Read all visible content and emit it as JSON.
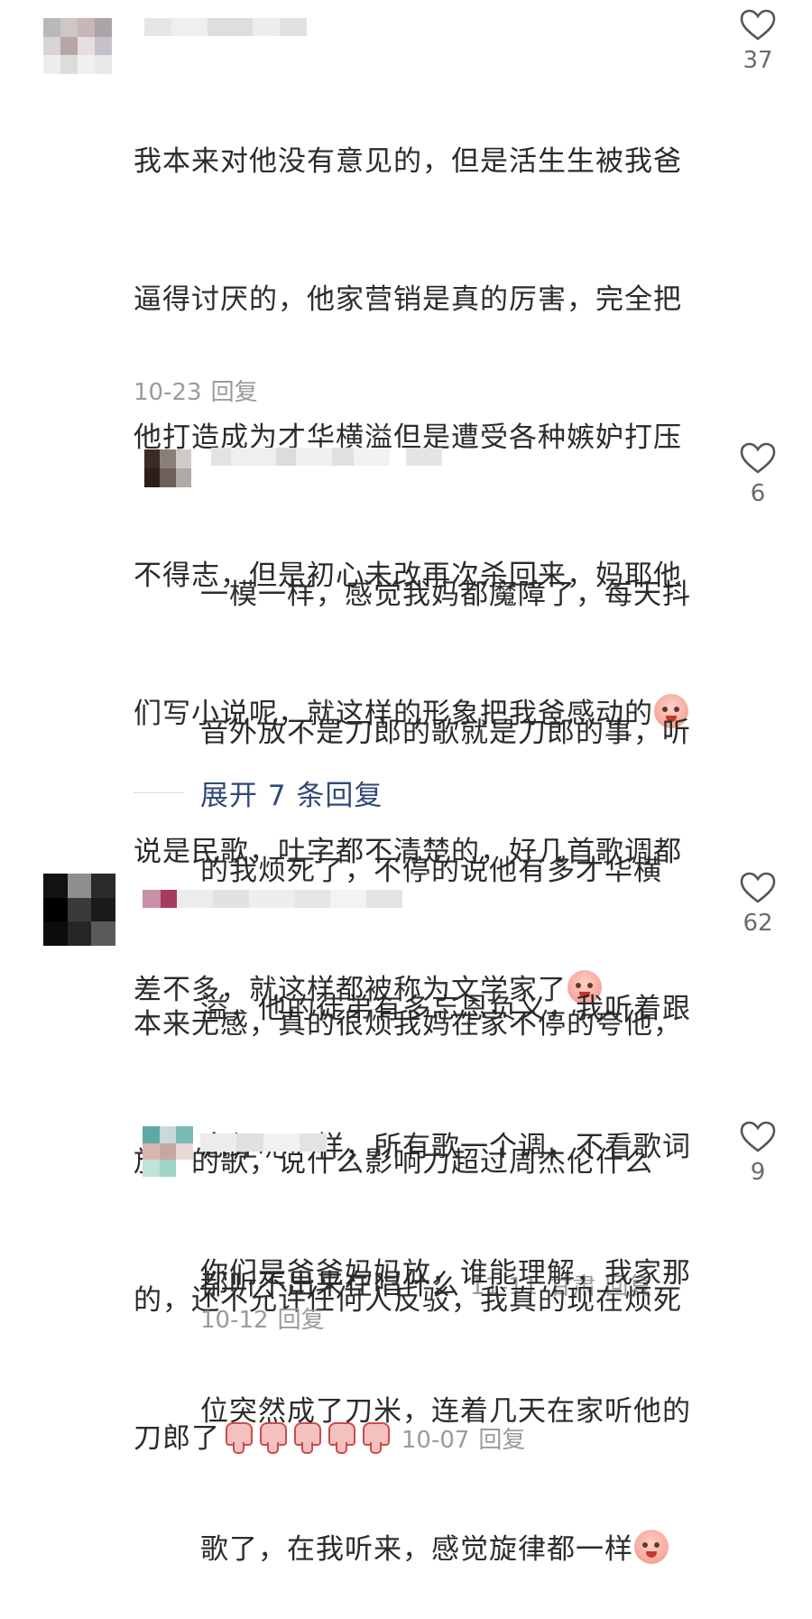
{
  "comments": [
    {
      "text_lines": [
        "我本来对他没有意见的，但是活生生被我爸",
        "逼得讨厌的，他家营销是真的厉害，完全把",
        "他打造成为才华横溢但是遭受各种嫉妒打压",
        "不得志，但是初心未改再次杀回来，妈耶他",
        "们写小说呢，就这样的形象把我爸感动的"
      ],
      "text_lines2": [
        "说是民歌，吐字都不清楚的，好几首歌调都",
        "差不多，就这样都被称为文学家了"
      ],
      "date": "10-23",
      "reply_label": "回复",
      "likes": "37",
      "emoji": [
        "crying-face-icon",
        "crying-face-icon"
      ]
    },
    {
      "text_lines": [
        "一模一样，感觉我妈都魔障了，每天抖",
        "音外放不是刀郎的歌就是刀郎的事，听",
        "的我烦死了，不停的说他有多才华横",
        "溢，他的徒弟有多忘恩负义，我听着跟",
        "念经呢一样，所有歌一个调，不看歌词"
      ],
      "last_line": "都听不出来在唱什么",
      "date": "11-11",
      "location": "甘肃",
      "reply_label": "回复",
      "likes": "6"
    },
    {
      "text_lines": [
        "本来无感，真的很烦我妈在家不停的夸他，",
        "放他的歌，说什么影响力超过周杰伦什么",
        "的，还不允许任何人反驳，我真的现在烦死"
      ],
      "last_line": "刀郎了",
      "date": "10-07",
      "reply_label": "回复",
      "likes": "62",
      "emoji": [
        "dislike-icon",
        "dislike-icon",
        "dislike-icon",
        "dislike-icon",
        "dislike-icon"
      ]
    },
    {
      "text_lines": [
        "你们是爸爸妈妈放，谁能理解，我家那",
        "位突然成了刀米，连着几天在家听他的"
      ],
      "last_line": "歌了，在我听来，感觉旋律都一样",
      "date": "10-12",
      "reply_label": "回复",
      "likes": "9",
      "emoji": [
        "crying-face-icon"
      ]
    }
  ],
  "expand_replies": "展开 7 条回复",
  "colors": {
    "accent": "#2f4a78",
    "meta": "#9b9b9b",
    "text": "#2b2b2b"
  }
}
